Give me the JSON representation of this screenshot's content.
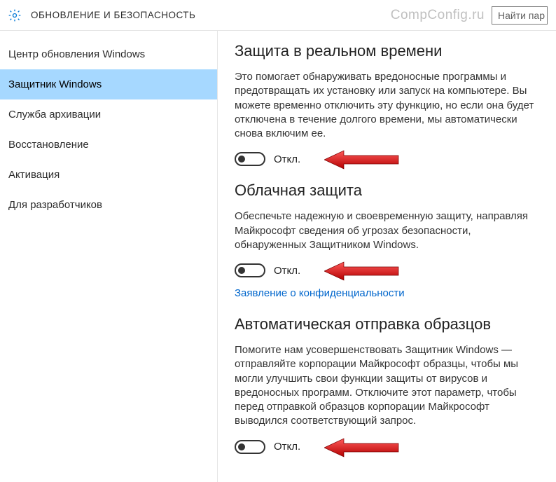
{
  "header": {
    "title": "ОБНОВЛЕНИЕ И БЕЗОПАСНОСТЬ",
    "watermark": "CompConfig.ru",
    "search_placeholder": "Найти пар"
  },
  "sidebar": {
    "items": [
      {
        "label": "Центр обновления Windows"
      },
      {
        "label": "Защитник Windows"
      },
      {
        "label": "Служба архивации"
      },
      {
        "label": "Восстановление"
      },
      {
        "label": "Активация"
      },
      {
        "label": "Для разработчиков"
      }
    ],
    "active_index": 1
  },
  "sections": [
    {
      "title": "Защита в реальном времени",
      "desc": "Это помогает обнаруживать вредоносные программы и предотвращать их установку или запуск на компьютере. Вы можете временно отключить эту функцию, но если она будет отключена в течение долгого времени, мы автоматически снова включим ее.",
      "toggle_label": "Откл."
    },
    {
      "title": "Облачная защита",
      "desc": "Обеспечьте надежную и своевременную защиту, направляя Майкрософт сведения об угрозах безопасности, обнаруженных Защитником Windows.",
      "toggle_label": "Откл.",
      "link": "Заявление о конфиденциальности"
    },
    {
      "title": "Автоматическая отправка образцов",
      "desc": "Помогите нам усовершенствовать Защитник Windows — отправляйте корпорации Майкрософт образцы, чтобы мы могли улучшить свои функции защиты от вирусов и вредоносных программ. Отключите этот параметр, чтобы перед отправкой образцов корпорации Майкрософт выводился соответствующий запрос.",
      "toggle_label": "Откл."
    }
  ]
}
